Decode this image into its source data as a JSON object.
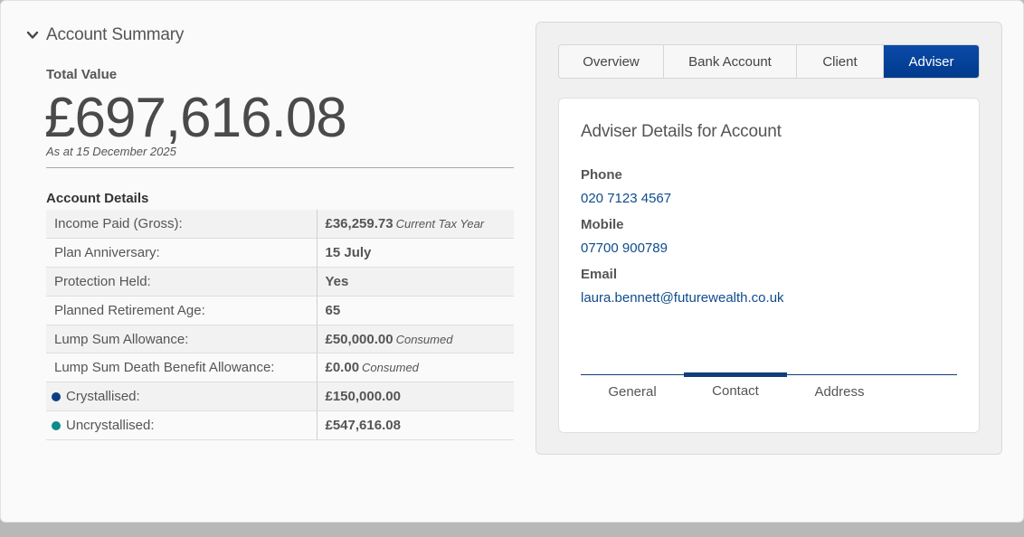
{
  "summary": {
    "toggle_label": "Account Summary",
    "total_label": "Total Value",
    "total_value": "£697,616.08",
    "as_at": "As at 15 December 2025"
  },
  "details": {
    "heading": "Account Details",
    "rows": [
      {
        "label": "Income Paid (Gross):",
        "value": "£36,259.73",
        "note": "Current Tax Year"
      },
      {
        "label": "Plan Anniversary:",
        "value": "15 July",
        "note": ""
      },
      {
        "label": "Protection Held:",
        "value": "Yes",
        "note": ""
      },
      {
        "label": "Planned Retirement Age:",
        "value": "65",
        "note": ""
      },
      {
        "label": "Lump Sum Allowance:",
        "value": "£50,000.00",
        "note": "Consumed"
      },
      {
        "label": "Lump Sum Death Benefit Allowance:",
        "value": "£0.00",
        "note": "Consumed"
      },
      {
        "label": "Crystallised:",
        "value": "£150,000.00",
        "note": "",
        "dot_color": "#0b3f86"
      },
      {
        "label": "Uncrystallised:",
        "value": "£547,616.08",
        "note": "",
        "dot_color": "#0e8a8a"
      }
    ]
  },
  "tabs": [
    {
      "label": "Overview",
      "active": false
    },
    {
      "label": "Bank Account",
      "active": false
    },
    {
      "label": "Client",
      "active": false
    },
    {
      "label": "Adviser",
      "active": true
    }
  ],
  "adviser": {
    "title": "Adviser Details for Account",
    "phone_label": "Phone",
    "phone": "020 7123 4567",
    "mobile_label": "Mobile",
    "mobile": "07700 900789",
    "email_label": "Email",
    "email": "laura.bennett@futurewealth.co.uk"
  },
  "subtabs": [
    {
      "label": "General",
      "active": false
    },
    {
      "label": "Contact",
      "active": true
    },
    {
      "label": "Address",
      "active": false
    }
  ],
  "colors": {
    "accent": "#003a8c",
    "link": "#0e4c8c",
    "crystallised_dot": "#0b3f86",
    "uncrystallised_dot": "#0e8a8a"
  }
}
